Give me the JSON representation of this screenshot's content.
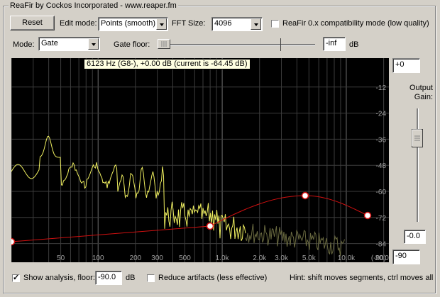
{
  "window": {
    "title": "ReaFir by Cockos Incorporated - www.reaper.fm"
  },
  "toolbar": {
    "reset_label": "Reset",
    "edit_mode_label": "Edit mode:",
    "edit_mode_value": "Points (smooth)",
    "fft_size_label": "FFT Size:",
    "fft_size_value": "4096",
    "compat_label": "ReaFir 0.x compatibility mode (low quality)",
    "compat_checked": false
  },
  "mode_row": {
    "mode_label": "Mode:",
    "mode_value": "Gate",
    "gate_floor_label": "Gate floor:",
    "gate_floor_value": "-inf",
    "gate_floor_unit": "dB"
  },
  "graph": {
    "tooltip": "6123 Hz (G8-), +0.00 dB (current is -64.45 dB)",
    "y_ticks": [
      "-12",
      "-24",
      "-36",
      "-48",
      "-60",
      "-72",
      "-84",
      "(-90)"
    ],
    "x_ticks": [
      "50",
      "100",
      "200",
      "300",
      "500",
      "1.0k",
      "2.0k",
      "3.0k",
      "5.0k",
      "10.0k",
      "20.0k"
    ],
    "colors": {
      "background": "#000000",
      "analysis": "#f0f060",
      "curve": "#d01010",
      "grid": "#505050"
    }
  },
  "output": {
    "top_value": "+0",
    "label": "Output Gain:",
    "gain_value": "-0.0",
    "bottom_value": "-90"
  },
  "bottom": {
    "show_analysis_label": "Show analysis, floor:",
    "show_analysis_checked": true,
    "floor_value": "-90.0",
    "floor_unit": "dB",
    "reduce_artifacts_label": "Reduce artifacts (less effective)",
    "reduce_artifacts_checked": false,
    "hint": "Hint: shift moves segments, ctrl moves all"
  }
}
